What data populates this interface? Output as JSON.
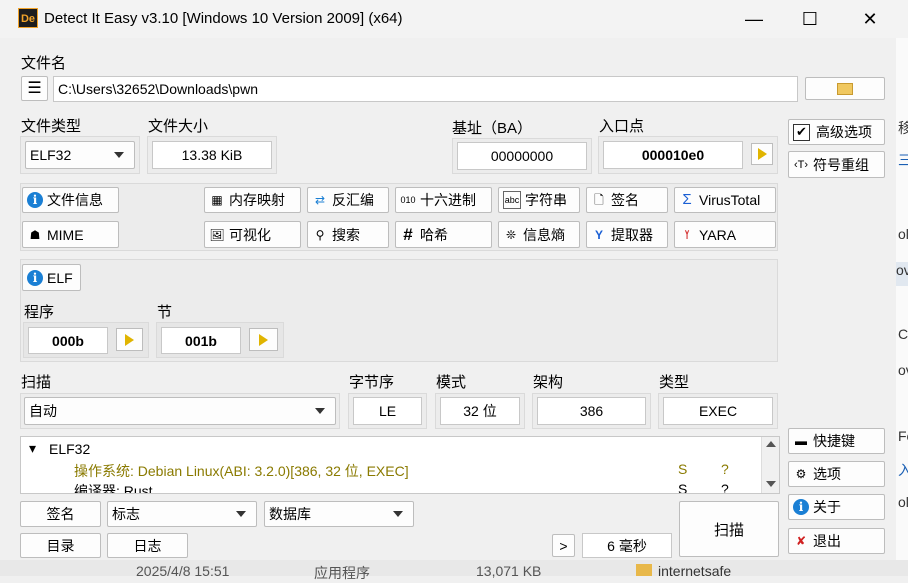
{
  "window": {
    "title": "Detect It Easy v3.10 [Windows 10 Version 2009] (x64)",
    "icon": "De",
    "minimize": "—",
    "maximize": "☐",
    "close": "✕"
  },
  "file": {
    "label": "文件名",
    "path": "C:\\Users\\32652\\Downloads\\pwn"
  },
  "info": {
    "type_label": "文件类型",
    "type_value": "ELF32",
    "size_label": "文件大小",
    "size_value": "13.38 KiB",
    "base_label": "基址（BA）",
    "base_value": "00000000",
    "entry_label": "入口点",
    "entry_value": "000010e0"
  },
  "right_panel": {
    "advanced": "高级选项",
    "demangle": "符号重组",
    "shortcuts": "快捷键",
    "options": "选项",
    "about": "关于",
    "exit": "退出"
  },
  "tools": {
    "file_info": "文件信息",
    "memory_map": "内存映射",
    "disasm": "反汇编",
    "hex": "十六进制",
    "strings": "字符串",
    "signatures": "签名",
    "virustotal": "VirusTotal",
    "mime": "MIME",
    "visualize": "可视化",
    "search": "搜索",
    "hash": "哈希",
    "entropy": "信息熵",
    "extractor": "提取器",
    "yara": "YARA"
  },
  "elf": {
    "tab": "ELF",
    "programs_label": "程序",
    "programs_value": "000b",
    "sections_label": "节",
    "sections_value": "001b"
  },
  "scan": {
    "label": "扫描",
    "mode_value": "自动",
    "endian_label": "字节序",
    "endian_value": "LE",
    "mode_label": "模式",
    "bits_value": "32 位",
    "arch_label": "架构",
    "arch_value": "386",
    "type_label": "类型",
    "type_value": "EXEC"
  },
  "results": {
    "root": "ELF32",
    "rows": [
      {
        "text": "操作系统: Debian Linux(ABI: 3.2.0)[386, 32 位, EXEC]",
        "s": "S",
        "q": "?",
        "color": "#8a7a00"
      },
      {
        "text": "编译器: Rust",
        "s": "S",
        "q": "?",
        "color": "#000000"
      }
    ]
  },
  "bottom": {
    "signatures": "签名",
    "flags": "标志",
    "database": "数据库",
    "scan": "扫描",
    "directory": "目录",
    "log": "日志",
    "more": ">",
    "time": "6 毫秒"
  },
  "background": {
    "date": "2025/4/8 15:51",
    "kind": "应用程序",
    "size": "13,071 KB",
    "folder": "internetsafe",
    "edge_chars": [
      "移",
      "三",
      "ol",
      "ov",
      "C",
      "ov",
      "Fe",
      "入",
      "ol"
    ]
  },
  "colors": {
    "accent": "#1a7fd4",
    "arrow": "#e0b400"
  }
}
